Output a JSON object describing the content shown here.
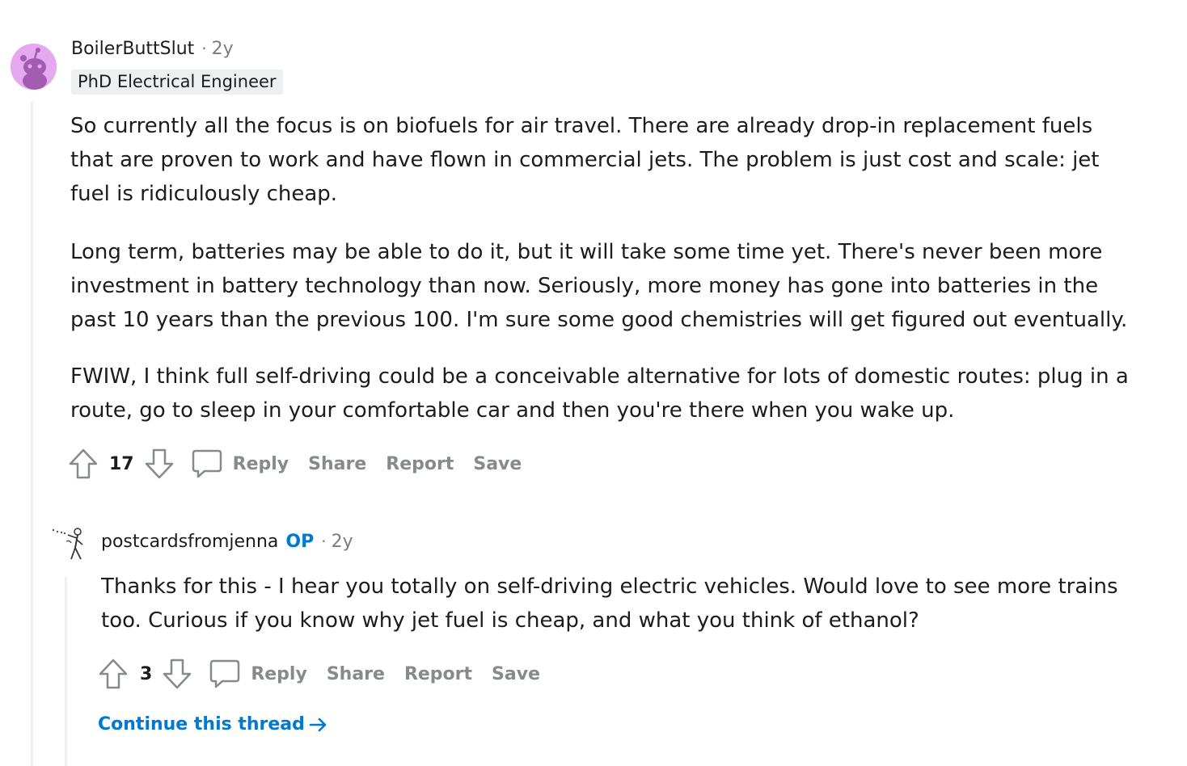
{
  "comment1": {
    "username": "BoilerButtSlut",
    "separator": "·",
    "age": "2y",
    "flair": "PhD Electrical Engineer",
    "paragraphs": [
      [
        "So currently all the focus is on biofuels for air travel. There are already drop-in replacement fuels",
        "that are proven to work and have flown in commercial jets. The problem is just cost and scale: jet",
        "fuel is ridiculously cheap."
      ],
      [
        "Long term, batteries may be able to do it, but it will take some time yet. There's never been more",
        "investment in battery technology than now. Seriously, more money has gone into batteries in the",
        "past 10 years than the previous 100. I'm sure some good chemistries will get figured out eventually."
      ],
      [
        "FWIW, I think full self-driving could be a conceivable alternative for lots of domestic routes: plug in a",
        "route, go to sleep in your comfortable car and then you're there when you wake up."
      ]
    ],
    "votes": "17",
    "reply_label": "Reply",
    "share_label": "Share",
    "report_label": "Report",
    "save_label": "Save",
    "avatar_icon": "reddit-snoo-avatar-icon"
  },
  "comment2": {
    "username": "postcardsfromjenna",
    "op_badge": "OP",
    "separator": "·",
    "age": "2y",
    "paragraphs": [
      [
        "Thanks for this - I hear you totally on self-driving electric vehicles. Would love to see more trains",
        "too. Curious if you know why jet fuel is cheap, and what you think of ethanol?"
      ]
    ],
    "votes": "3",
    "reply_label": "Reply",
    "share_label": "Share",
    "report_label": "Report",
    "save_label": "Save",
    "avatar_icon": "sketch-figure-avatar-icon"
  },
  "continue_thread": "Continue this thread",
  "colors": {
    "text": "#1c1c1c",
    "meta": "#7c7c7c",
    "action": "#878a8c",
    "link": "#0079d3",
    "thread_line": "#edeff1",
    "flair_bg": "#edeff1",
    "avatar_bg": "#e6a8f0"
  }
}
